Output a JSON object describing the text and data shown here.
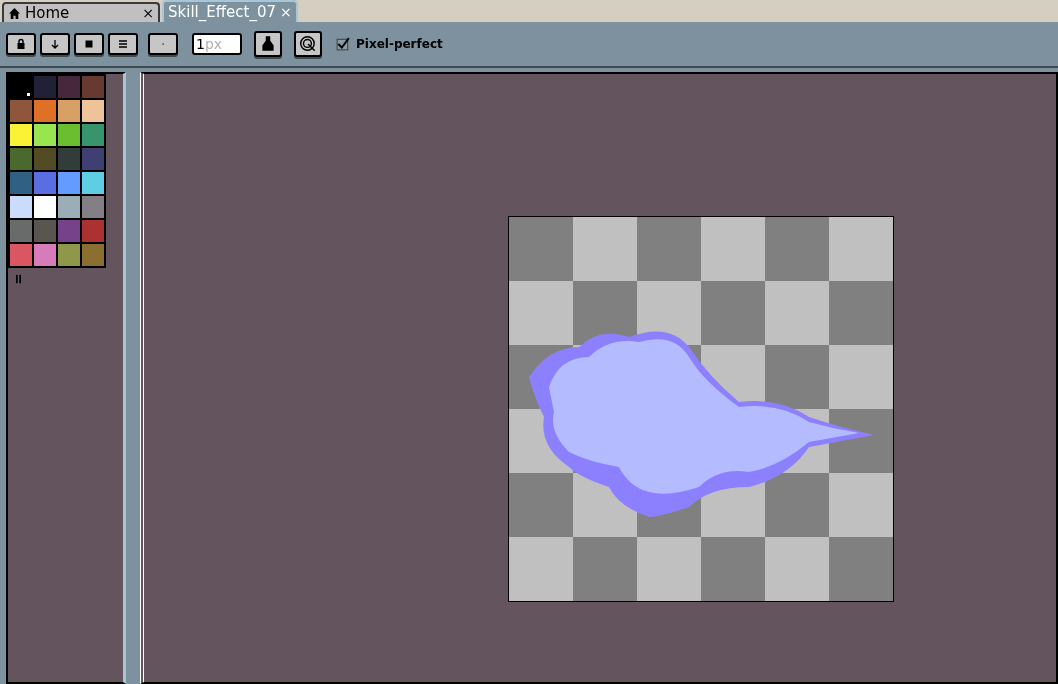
{
  "tabs": [
    {
      "label": "Home",
      "kind": "home",
      "selected": false,
      "close": "×"
    },
    {
      "label": "Skill_Effect_07",
      "kind": "file",
      "selected": true,
      "close": "×"
    }
  ],
  "toolbar": {
    "buttons": [
      {
        "kind": "lock"
      },
      {
        "kind": "down"
      },
      {
        "kind": "square"
      },
      {
        "kind": "menu"
      },
      {
        "kind": "dot"
      }
    ],
    "brush_size": {
      "value": "1",
      "suffix": "px"
    },
    "tools": [
      {
        "kind": "ink"
      },
      {
        "kind": "target"
      }
    ],
    "pixel_perfect": {
      "label": "Pixel-perfect",
      "checked": true
    }
  },
  "palette": [
    {
      "color": "#000000",
      "selected": true
    },
    {
      "color": "#222034",
      "selected": false
    },
    {
      "color": "#45283c",
      "selected": false
    },
    {
      "color": "#663931",
      "selected": false
    },
    {
      "color": "#8f563b",
      "selected": false
    },
    {
      "color": "#df7126",
      "selected": false
    },
    {
      "color": "#d9a066",
      "selected": false
    },
    {
      "color": "#eec39a",
      "selected": false
    },
    {
      "color": "#fbf236",
      "selected": false
    },
    {
      "color": "#99e550",
      "selected": false
    },
    {
      "color": "#6abe30",
      "selected": false
    },
    {
      "color": "#37946e",
      "selected": false
    },
    {
      "color": "#4b692f",
      "selected": false
    },
    {
      "color": "#524b24",
      "selected": false
    },
    {
      "color": "#323c39",
      "selected": false
    },
    {
      "color": "#3f3f74",
      "selected": false
    },
    {
      "color": "#306082",
      "selected": false
    },
    {
      "color": "#5b6ee1",
      "selected": false
    },
    {
      "color": "#639bff",
      "selected": false
    },
    {
      "color": "#5fcde4",
      "selected": false
    },
    {
      "color": "#cbdbfc",
      "selected": false
    },
    {
      "color": "#ffffff",
      "selected": false
    },
    {
      "color": "#9badb7",
      "selected": false
    },
    {
      "color": "#847e87",
      "selected": false
    },
    {
      "color": "#696a6a",
      "selected": false
    },
    {
      "color": "#595652",
      "selected": false
    },
    {
      "color": "#76428a",
      "selected": false
    },
    {
      "color": "#ac3232",
      "selected": false
    },
    {
      "color": "#d95763",
      "selected": false
    },
    {
      "color": "#d77bba",
      "selected": false
    },
    {
      "color": "#8f974a",
      "selected": false
    },
    {
      "color": "#8a6f30",
      "selected": false
    }
  ]
}
